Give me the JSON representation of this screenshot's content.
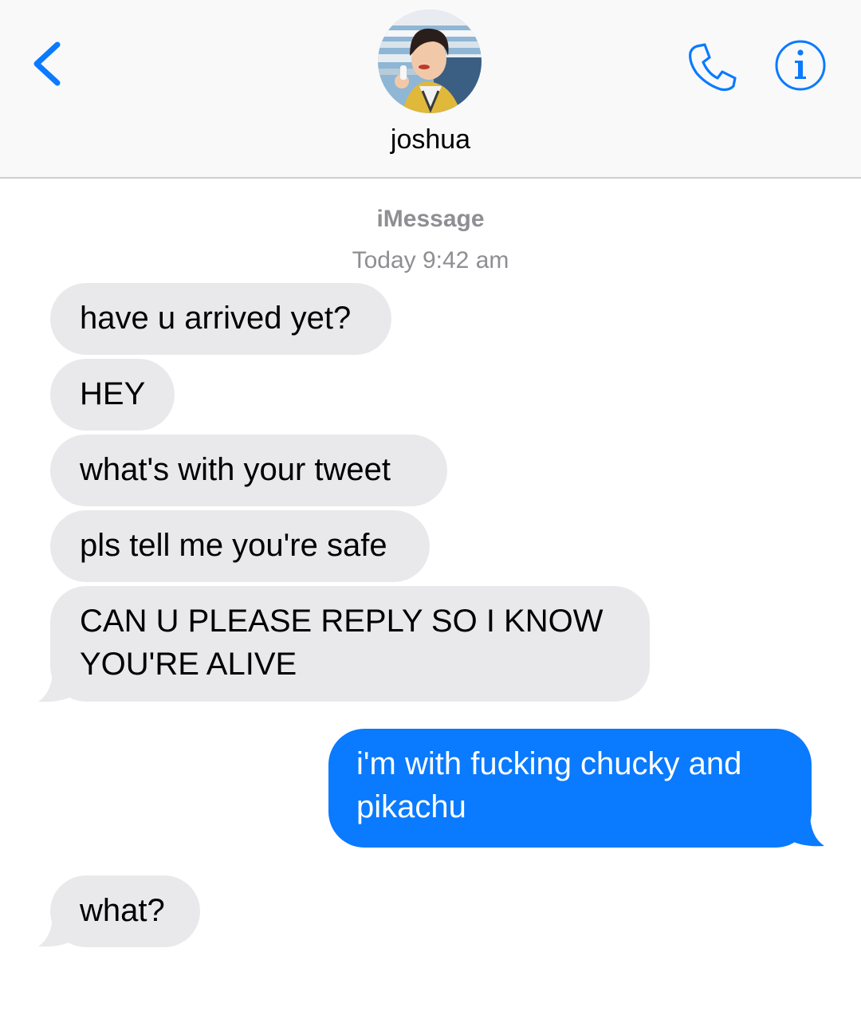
{
  "header": {
    "contact_name": "joshua",
    "icons": {
      "back": "chevron-left-icon",
      "call": "phone-icon",
      "info": "info-icon"
    }
  },
  "thread": {
    "service": "iMessage",
    "timestamp": "Today 9:42 am",
    "messages": [
      {
        "from": "them",
        "text": "have u arrived yet?"
      },
      {
        "from": "them",
        "text": "HEY"
      },
      {
        "from": "them",
        "text": "what's with your tweet"
      },
      {
        "from": "them",
        "text": "pls tell me you're safe"
      },
      {
        "from": "them",
        "line1": "CAN U PLEASE REPLY SO I KNOW",
        "line2": "YOU'RE ALIVE"
      },
      {
        "from": "me",
        "line1": "i'm with fucking chucky and",
        "line2": "pikachu"
      },
      {
        "from": "them",
        "text": "what?"
      }
    ]
  },
  "colors": {
    "accent": "#0a7aff",
    "incoming_bubble": "#e9e9eb",
    "header_bg": "#f9f9f9",
    "meta_text": "#8e8e93"
  }
}
